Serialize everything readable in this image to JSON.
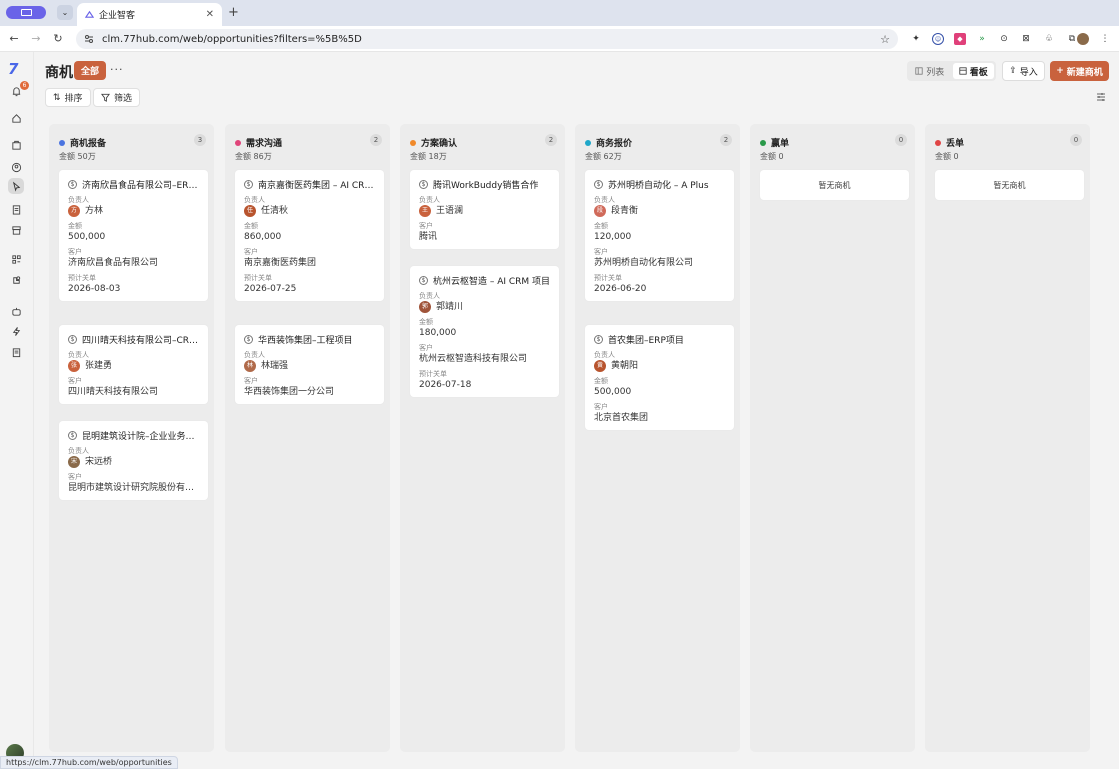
{
  "browser": {
    "tab_title": "企业智客",
    "url": "clm.77hub.com/web/opportunities?filters=%5B%5D",
    "status_url": "https://clm.77hub.com/web/opportunities"
  },
  "nav": {
    "notification_count": "6"
  },
  "header": {
    "title": "商机",
    "filter_badge": "全部",
    "more": "···",
    "sort_label": "排序",
    "filter_label": "筛选",
    "view_list": "列表",
    "view_board": "看板",
    "import_label": "导入",
    "new_label": "新建商机"
  },
  "fields": {
    "owner": "负责人",
    "amount": "金额",
    "customer": "客户",
    "close_date": "预计关单"
  },
  "empty_text": "暂无商机",
  "colors": {
    "accent": "#c9623d",
    "stage_report": "#4a74e0",
    "stage_needs": "#e0457a",
    "stage_solution": "#f0892a",
    "stage_quote": "#1fa7c9",
    "stage_won": "#2a9a4a",
    "stage_lost": "#e04545"
  },
  "columns": [
    {
      "name": "商机报备",
      "count": "3",
      "amount": "金额 50万",
      "cards": [
        {
          "title": "济南欣昌食品有限公司–ERP系统",
          "owner": "方林",
          "owner_initial": "方",
          "amount": "500,000",
          "customer": "济南欣昌食品有限公司",
          "close_date": "2026-08-03"
        },
        {
          "title": "四川晴天科技有限公司–CRM项目",
          "owner": "张建勇",
          "owner_initial": "张",
          "customer": "四川晴天科技有限公司"
        },
        {
          "title": "昆明建筑设计院–企业业务系统",
          "owner": "宋远桥",
          "owner_initial": "宋",
          "customer": "昆明市建筑设计研究院股份有限公司"
        }
      ]
    },
    {
      "name": "需求沟通",
      "count": "2",
      "amount": "金额 86万",
      "cards": [
        {
          "title": "南京嘉衡医药集团 – AI CRM项目",
          "owner": "任清秋",
          "owner_initial": "任",
          "amount": "860,000",
          "customer": "南京嘉衡医药集团",
          "close_date": "2026-07-25"
        },
        {
          "title": "华西装饰集团–工程项目",
          "owner": "林瑞强",
          "owner_initial": "林",
          "customer": "华西装饰集团一分公司"
        }
      ]
    },
    {
      "name": "方案确认",
      "count": "2",
      "amount": "金额 18万",
      "cards": [
        {
          "title": "腾讯WorkBuddy销售合作",
          "owner": "王语澜",
          "owner_initial": "王",
          "customer": "腾讯"
        },
        {
          "title": "杭州云枢智造 – AI CRM 项目",
          "owner": "郭靖川",
          "owner_initial": "郭",
          "amount": "180,000",
          "customer": "杭州云枢智造科技有限公司",
          "close_date": "2026-07-18"
        }
      ]
    },
    {
      "name": "商务报价",
      "count": "2",
      "amount": "金额 62万",
      "cards": [
        {
          "title": "苏州明桥自动化 – A Plus",
          "owner": "段青衡",
          "owner_initial": "段",
          "amount": "120,000",
          "customer": "苏州明桥自动化有限公司",
          "close_date": "2026-06-20"
        },
        {
          "title": "首农集团–ERP项目",
          "owner": "黄朝阳",
          "owner_initial": "黄",
          "amount": "500,000",
          "customer": "北京首农集团"
        }
      ]
    },
    {
      "name": "赢单",
      "count": "0",
      "amount": "金额 0",
      "cards": []
    },
    {
      "name": "丢单",
      "count": "0",
      "amount": "金额 0",
      "cards": []
    }
  ]
}
